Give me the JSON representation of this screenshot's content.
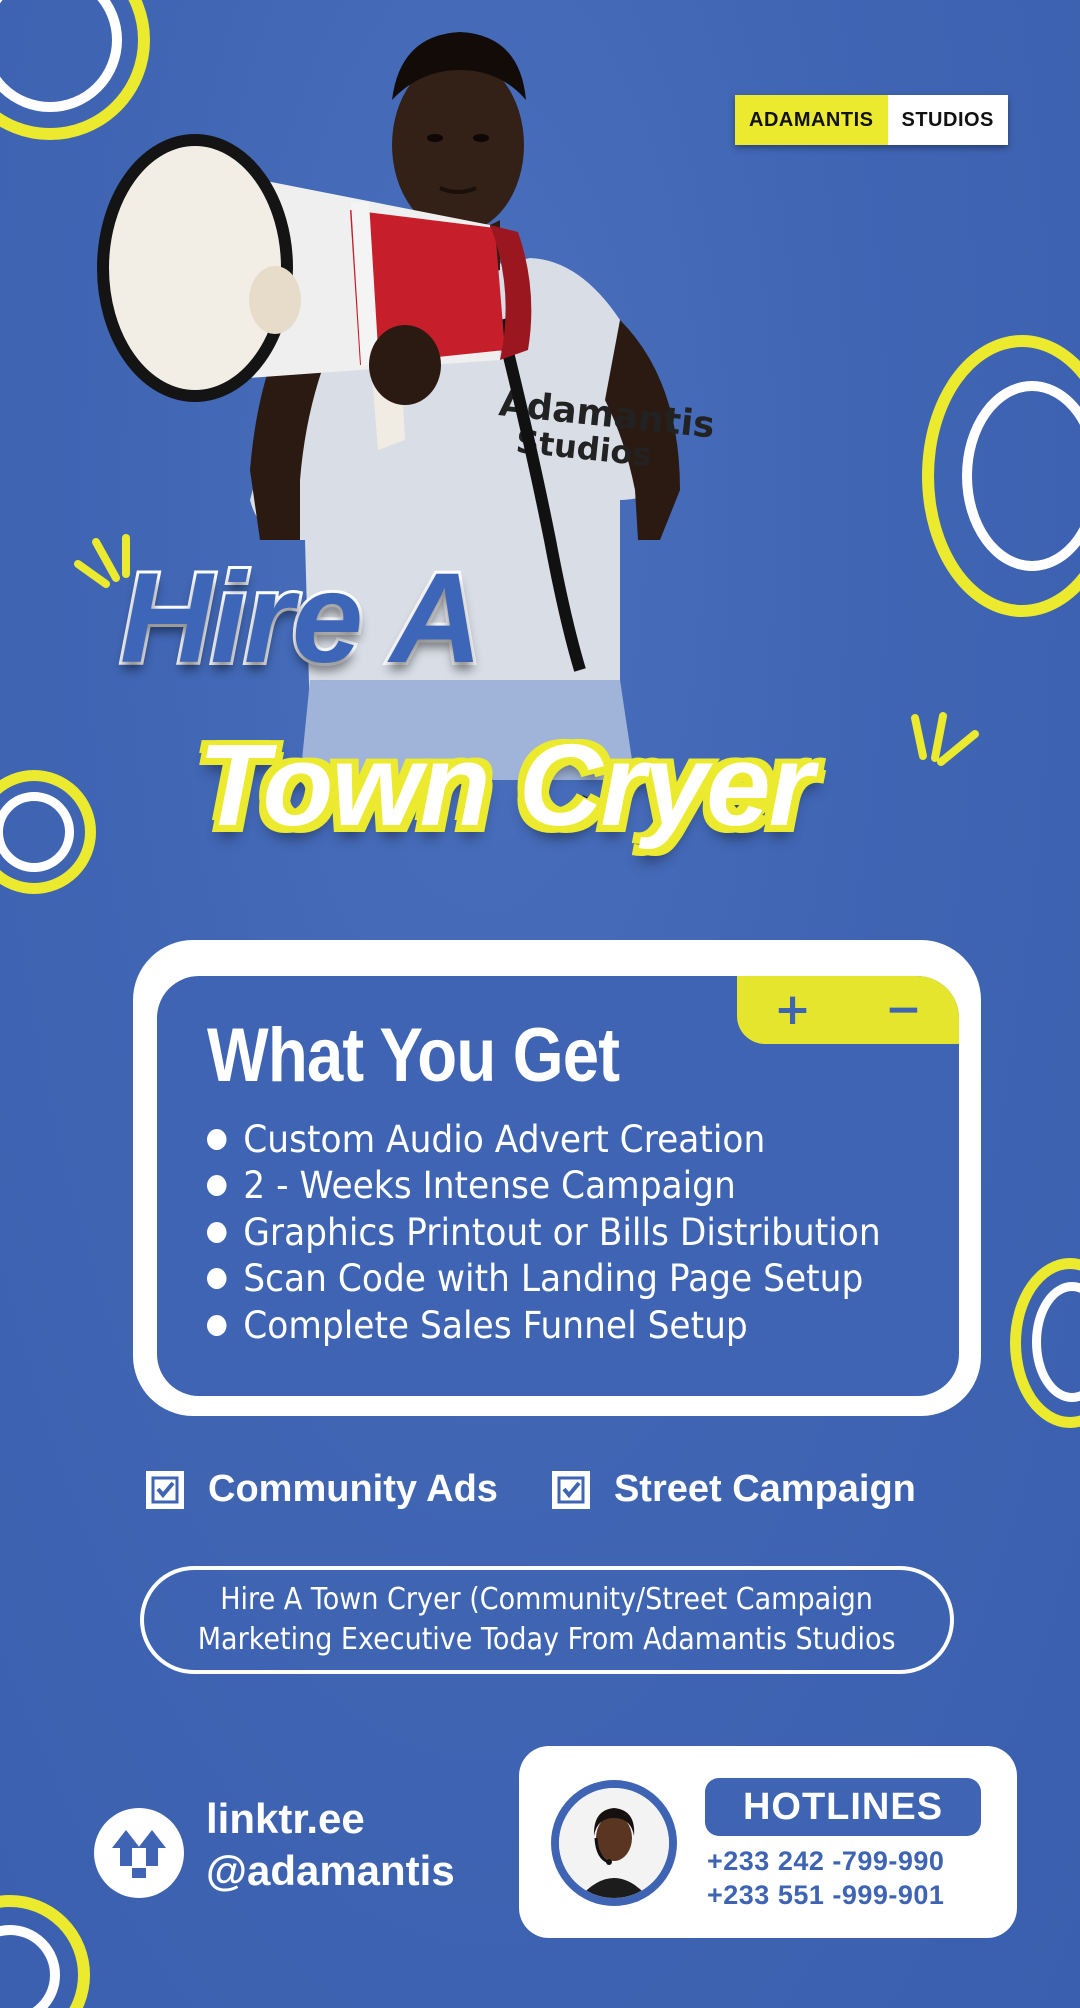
{
  "brand": {
    "left": "ADAMANTIS",
    "right": "STUDIOS"
  },
  "hero": {
    "shirt_line1": "Adamantis",
    "shirt_line2": "Studios"
  },
  "headline": {
    "line1": "Hire A",
    "line2": "Town Cryer"
  },
  "card": {
    "tab_plus": "+",
    "tab_minus": "−",
    "title": "What You Get",
    "items": [
      "Custom Audio Advert Creation",
      "2 - Weeks Intense Campaign",
      "Graphics Printout or Bills Distribution",
      "Scan Code with Landing Page Setup",
      "Complete Sales Funnel Setup"
    ]
  },
  "checks": [
    "Community Ads",
    "Street Campaign"
  ],
  "cta": {
    "line1": "Hire A Town Cryer (Community/Street Campaign",
    "line2": "Marketing Executive Today From Adamantis Studios"
  },
  "link": {
    "line1": "linktr.ee",
    "line2": "@adamantis"
  },
  "hotlines": {
    "label": "HOTLINES",
    "phones": [
      "+233 242 -799-990",
      "+233 551 -999-901"
    ]
  },
  "colors": {
    "background": "#3e64b3",
    "accent_yellow": "#ecea2e",
    "white": "#ffffff"
  }
}
